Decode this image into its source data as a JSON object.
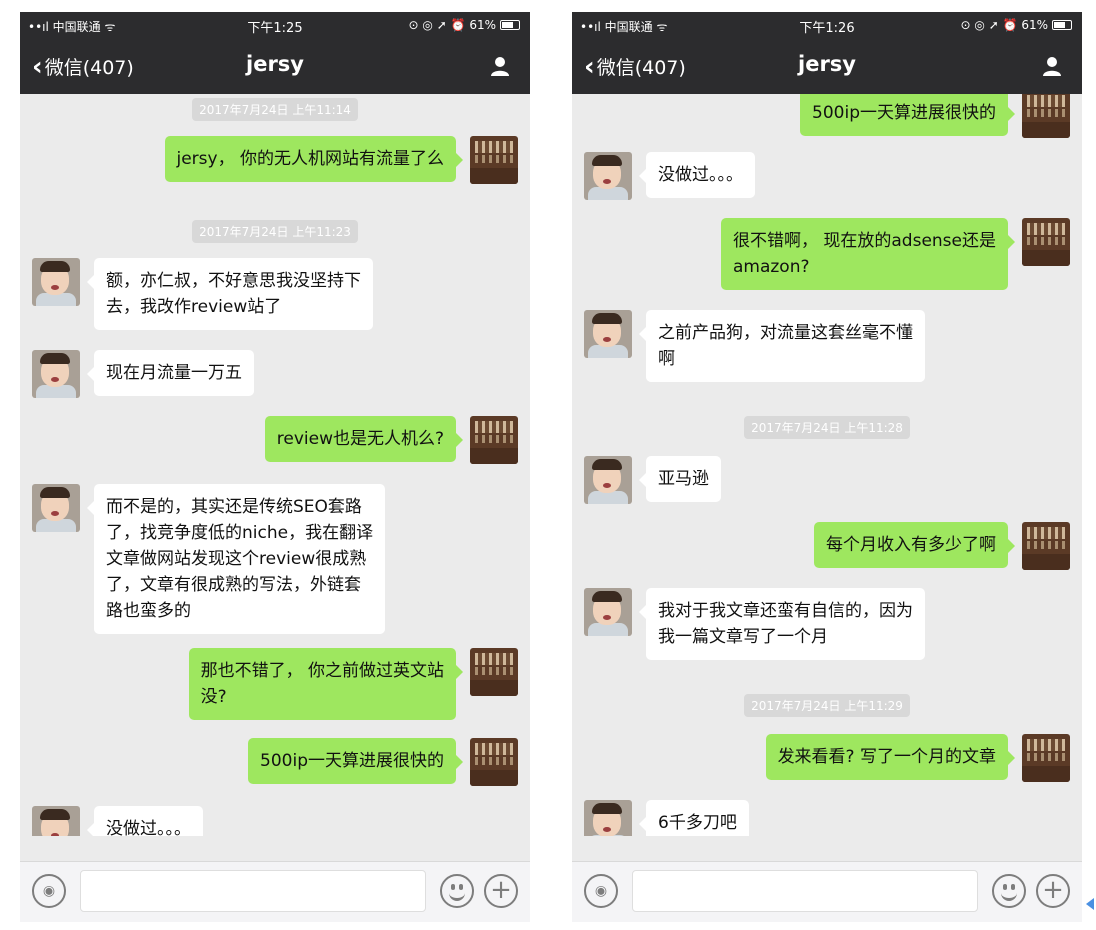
{
  "phones": [
    {
      "status": {
        "carrier": "••ıl 中国联通 ᯤ",
        "time": "下午1:25",
        "indicators": "⊙ ◎ ➚ ⏰ 61%"
      },
      "nav": {
        "back": "微信(407)",
        "title": "jersy"
      },
      "chat": {
        "timestamps": [
          "2017年7月24日 上午11:14",
          "2017年7月24日 上午11:23"
        ],
        "messages": [
          "jersy， 你的无人机网站有流量了么",
          "额，亦仁叔，不好意思我没坚持下\n去，我改作review站了",
          "现在月流量一万五",
          "review也是无人机么?",
          "而不是的，其实还是传统SEO套路\n了，找竞争度低的niche，我在翻译\n文章做网站发现这个review很成熟\n了，文章有很成熟的写法，外链套\n路也蛮多的",
          "那也不错了， 你之前做过英文站\n没?",
          "500ip一天算进展很快的",
          "没做过。。。"
        ]
      },
      "input": {
        "value": ""
      }
    },
    {
      "status": {
        "carrier": "••ıl 中国联通 ᯤ",
        "time": "下午1:26",
        "indicators": "⊙ ◎ ➚ ⏰ 61%"
      },
      "nav": {
        "back": "微信(407)",
        "title": "jersy"
      },
      "chat": {
        "timestamps": [
          "2017年7月24日 上午11:28",
          "2017年7月24日 上午11:29"
        ],
        "messages": [
          "500ip一天算进展很快的",
          "没做过。。。",
          "很不错啊， 现在放的adsense还是\namazon?",
          "之前产品狗，对流量这套丝毫不懂\n啊",
          "亚马逊",
          "每个月收入有多少了啊",
          "我对于我文章还蛮有自信的，因为\n我一篇文章写了一个月",
          "发来看看? 写了一个月的文章",
          "6千多刀吧"
        ]
      },
      "input": {
        "value": ""
      }
    }
  ],
  "icons": {
    "back": "chevron-left-icon",
    "contact": "user-icon",
    "voice": "voice-icon",
    "emoji": "emoji-icon",
    "more": "plus-icon"
  },
  "colors": {
    "outgoing_bubble": "#9ee75f",
    "incoming_bubble": "#ffffff",
    "navbar": "#2c2c2e",
    "chat_bg": "#ebebeb"
  }
}
